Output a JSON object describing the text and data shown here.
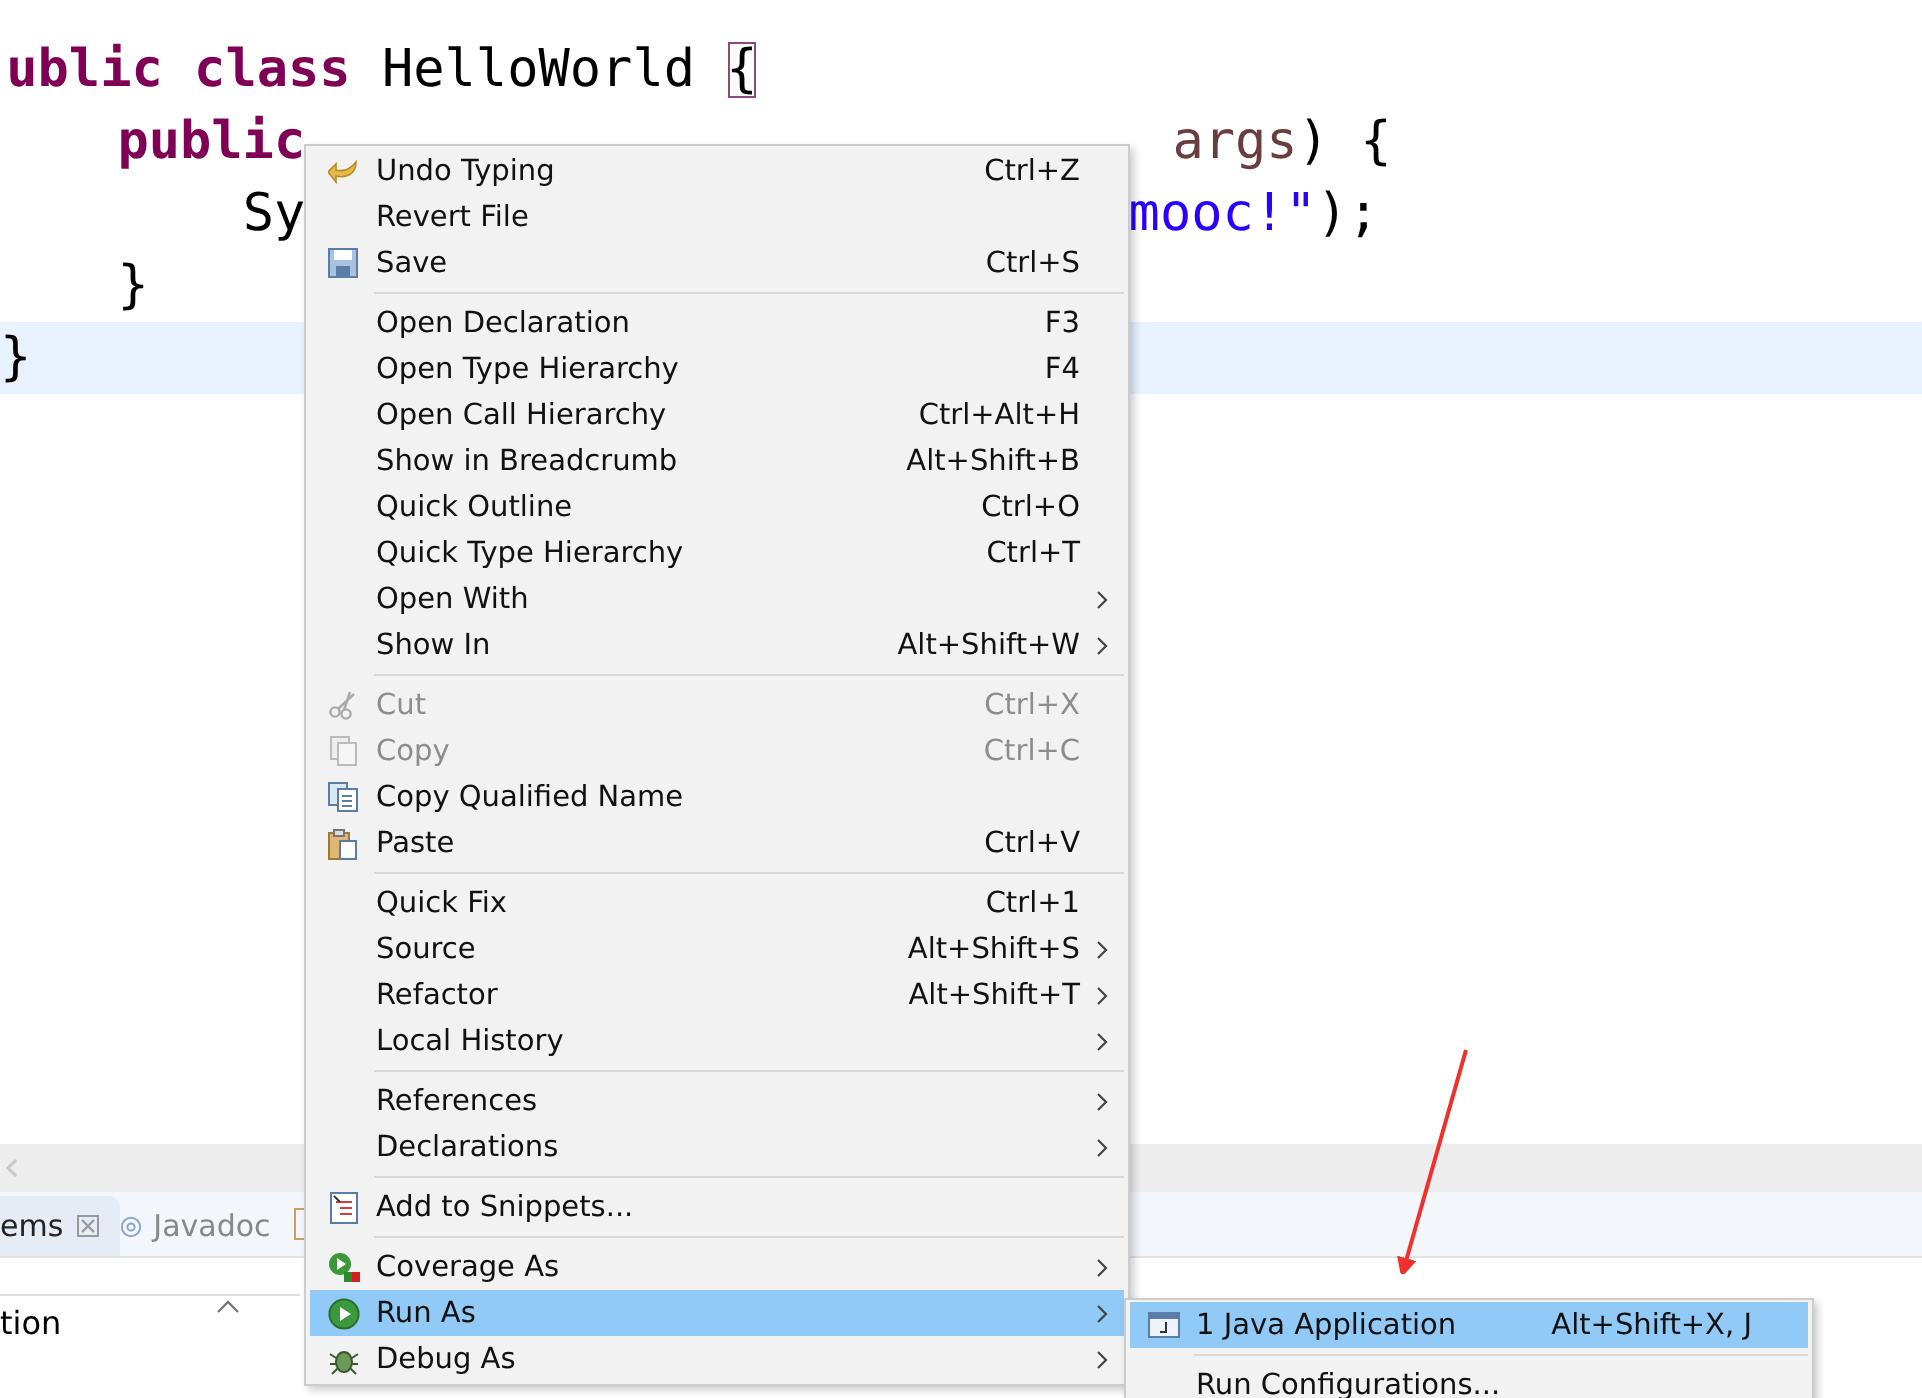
{
  "editor": {
    "lines": [
      {
        "segments": [
          {
            "text": "ublic class",
            "kind": "keyword"
          },
          {
            "text": " HelloWorld ",
            "kind": "plain"
          },
          {
            "text": "{",
            "kind": "bracket"
          }
        ],
        "current": false
      },
      {
        "segments": [
          {
            "text": "public",
            "kind": "keyword"
          }
        ],
        "right": [
          {
            "text": "args",
            "kind": "variable"
          },
          {
            "text": ") {",
            "kind": "plain"
          }
        ],
        "current": false
      },
      {
        "segments": [
          {
            "text": "Sy",
            "kind": "plain"
          }
        ],
        "right": [
          {
            "text": "mooc!\"",
            "kind": "string"
          },
          {
            "text": ");",
            "kind": "plain"
          }
        ],
        "current": false
      },
      {
        "segments": [
          {
            "text": "}",
            "kind": "plain"
          }
        ],
        "current": false
      },
      {
        "segments": [
          {
            "text": "}",
            "kind": "plain"
          }
        ],
        "current": true
      }
    ]
  },
  "bottom_panel": {
    "tabs": [
      {
        "label": "ems",
        "selected": true,
        "closable": true
      },
      {
        "label": "Javadoc",
        "selected": false,
        "closable": false
      }
    ],
    "column_1": "tion"
  },
  "context_menu": {
    "groups": [
      [
        {
          "label": "Undo Typing",
          "shortcut": "Ctrl+Z",
          "submenu": false,
          "disabled": false,
          "selected": false
        },
        {
          "label": "Revert File",
          "submenu": false,
          "disabled": false,
          "selected": false
        },
        {
          "label": "Save",
          "shortcut": "Ctrl+S",
          "submenu": false,
          "disabled": false,
          "selected": false
        }
      ],
      [
        {
          "label": "Open Declaration",
          "shortcut": "F3",
          "submenu": false,
          "disabled": false,
          "selected": false
        },
        {
          "label": "Open Type Hierarchy",
          "shortcut": "F4",
          "submenu": false,
          "disabled": false,
          "selected": false
        },
        {
          "label": "Open Call Hierarchy",
          "shortcut": "Ctrl+Alt+H",
          "submenu": false,
          "disabled": false,
          "selected": false
        },
        {
          "label": "Show in Breadcrumb",
          "shortcut": "Alt+Shift+B",
          "submenu": false,
          "disabled": false,
          "selected": false
        },
        {
          "label": "Quick Outline",
          "shortcut": "Ctrl+O",
          "submenu": false,
          "disabled": false,
          "selected": false
        },
        {
          "label": "Quick Type Hierarchy",
          "shortcut": "Ctrl+T",
          "submenu": false,
          "disabled": false,
          "selected": false
        },
        {
          "label": "Open With",
          "submenu": true,
          "disabled": false,
          "selected": false
        },
        {
          "label": "Show In",
          "shortcut": "Alt+Shift+W",
          "submenu": true,
          "disabled": false,
          "selected": false
        }
      ],
      [
        {
          "label": "Cut",
          "shortcut": "Ctrl+X",
          "submenu": false,
          "disabled": true,
          "selected": false
        },
        {
          "label": "Copy",
          "shortcut": "Ctrl+C",
          "submenu": false,
          "disabled": true,
          "selected": false
        },
        {
          "label": "Copy Qualified Name",
          "submenu": false,
          "disabled": false,
          "selected": false
        },
        {
          "label": "Paste",
          "shortcut": "Ctrl+V",
          "submenu": false,
          "disabled": false,
          "selected": false
        }
      ],
      [
        {
          "label": "Quick Fix",
          "shortcut": "Ctrl+1",
          "submenu": false,
          "disabled": false,
          "selected": false
        },
        {
          "label": "Source",
          "shortcut": "Alt+Shift+S",
          "submenu": true,
          "disabled": false,
          "selected": false
        },
        {
          "label": "Refactor",
          "shortcut": "Alt+Shift+T",
          "submenu": true,
          "disabled": false,
          "selected": false
        },
        {
          "label": "Local History",
          "submenu": true,
          "disabled": false,
          "selected": false
        }
      ],
      [
        {
          "label": "References",
          "submenu": true,
          "disabled": false,
          "selected": false
        },
        {
          "label": "Declarations",
          "submenu": true,
          "disabled": false,
          "selected": false
        }
      ],
      [
        {
          "label": "Add to Snippets...",
          "submenu": false,
          "disabled": false,
          "selected": false
        }
      ],
      [
        {
          "label": "Coverage As",
          "submenu": true,
          "disabled": false,
          "selected": false
        },
        {
          "label": "Run As",
          "submenu": true,
          "disabled": false,
          "selected": true
        },
        {
          "label": "Debug As",
          "submenu": true,
          "disabled": false,
          "selected": false
        }
      ]
    ]
  },
  "submenu": {
    "groups": [
      [
        {
          "label": "1 Java Application",
          "shortcut": "Alt+Shift+X, J",
          "selected": true
        }
      ],
      [
        {
          "label": "Run Configurations...",
          "selected": false
        }
      ]
    ]
  }
}
